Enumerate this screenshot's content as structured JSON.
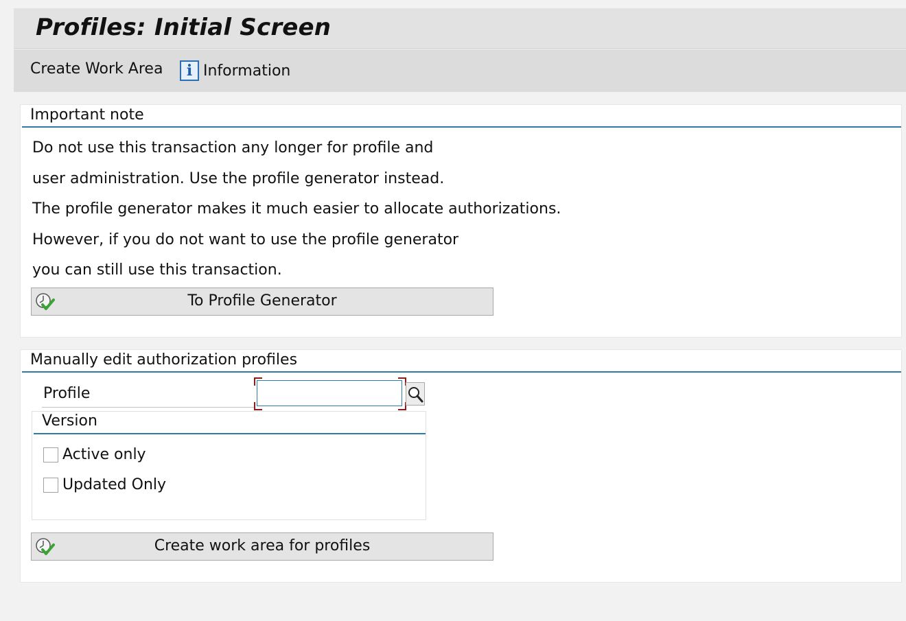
{
  "screen": {
    "title": "Profiles: Initial Screen"
  },
  "toolbar": {
    "create_work_area": "Create Work Area",
    "information": "Information",
    "information_icon": "info-icon"
  },
  "important_note": {
    "title": "Important note",
    "lines": [
      "Do not use this transaction any longer for profile and",
      "user administration. Use the profile generator instead.",
      "The profile generator makes it much easier to allocate authorizations.",
      "However, if you do not want to use the profile generator",
      "you can still use this transaction."
    ],
    "button_label": "To Profile Generator",
    "button_icon": "execute-clock-check-icon"
  },
  "manual_edit": {
    "title": "Manually edit authorization profiles",
    "profile_label": "Profile",
    "profile_value": "",
    "search_icon": "magnifier-search-icon",
    "version": {
      "title": "Version",
      "options": [
        {
          "label": "Active only",
          "checked": false
        },
        {
          "label": "Updated Only",
          "checked": false
        }
      ]
    },
    "button_label": "Create work area for profiles",
    "button_icon": "execute-clock-check-icon"
  },
  "colors": {
    "section_rule": "#2e7aa8",
    "focus_bracket": "#8a1c1c",
    "check_green": "#3aa336"
  }
}
